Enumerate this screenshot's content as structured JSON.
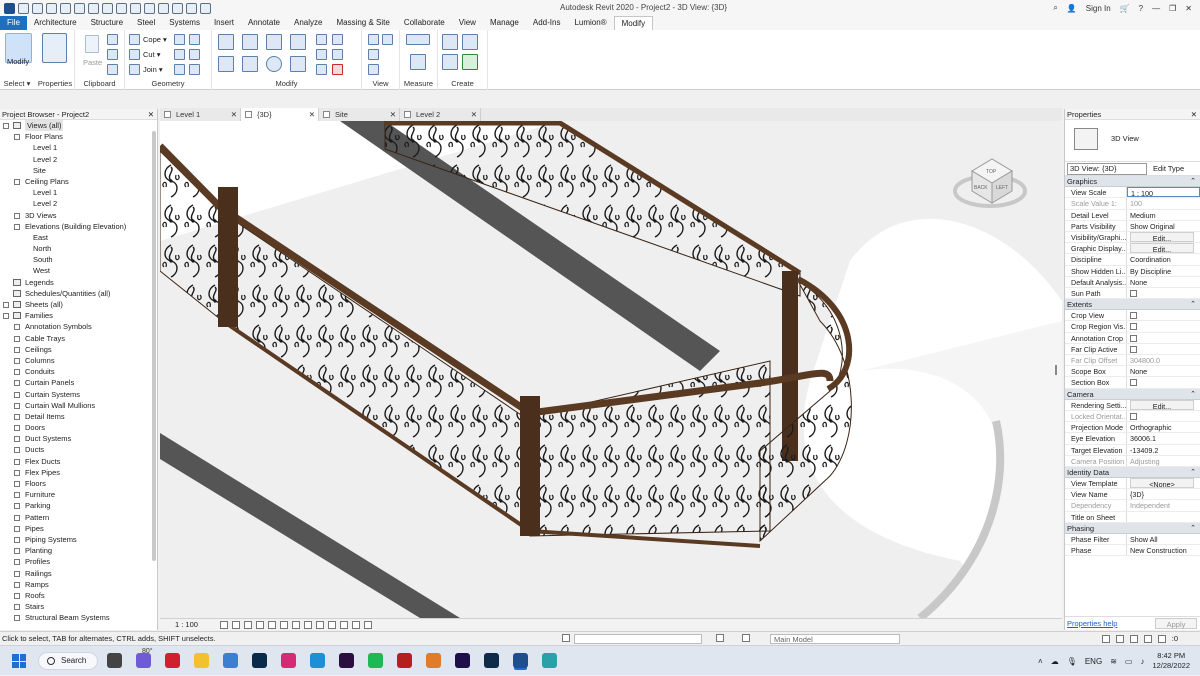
{
  "app": {
    "title": "Autodesk Revit 2020 - Project2 - 3D View: {3D}",
    "sign_in": "Sign In"
  },
  "tabs": [
    "File",
    "Architecture",
    "Structure",
    "Steel",
    "Systems",
    "Insert",
    "Annotate",
    "Analyze",
    "Massing & Site",
    "Collaborate",
    "View",
    "Manage",
    "Add-Ins",
    "Lumion®",
    "Modify"
  ],
  "ribbon": {
    "modify_label": "Modify",
    "panels": {
      "select": "Select ▾",
      "properties": "Properties",
      "clipboard": "Clipboard",
      "geometry": "Geometry",
      "modify": "Modify",
      "view": "View",
      "measure": "Measure",
      "create": "Create"
    },
    "clipboard_paste": "Paste",
    "geometry_items": [
      "Cope ▾",
      "Cut ▾",
      "Join ▾"
    ]
  },
  "project_browser": {
    "title": "Project Browser - Project2",
    "items": [
      {
        "label": "Views (all)",
        "level": 0,
        "tog": "-",
        "icon": true,
        "selected": true
      },
      {
        "label": "Floor Plans",
        "level": 1,
        "tog": "-"
      },
      {
        "label": "Level 1",
        "level": 2
      },
      {
        "label": "Level 2",
        "level": 2
      },
      {
        "label": "Site",
        "level": 2
      },
      {
        "label": "Ceiling Plans",
        "level": 1,
        "tog": "-"
      },
      {
        "label": "Level 1",
        "level": 2
      },
      {
        "label": "Level 2",
        "level": 2
      },
      {
        "label": "3D Views",
        "level": 1,
        "tog": "+"
      },
      {
        "label": "Elevations (Building Elevation)",
        "level": 1,
        "tog": "-"
      },
      {
        "label": "East",
        "level": 2
      },
      {
        "label": "North",
        "level": 2
      },
      {
        "label": "South",
        "level": 2
      },
      {
        "label": "West",
        "level": 2
      },
      {
        "label": "Legends",
        "level": 0,
        "icon": true
      },
      {
        "label": "Schedules/Quantities (all)",
        "level": 0,
        "icon": true
      },
      {
        "label": "Sheets (all)",
        "level": 0,
        "tog": "+",
        "icon": true
      },
      {
        "label": "Families",
        "level": 0,
        "tog": "-",
        "icon": true
      },
      {
        "label": "Annotation Symbols",
        "level": 1,
        "tog": "+"
      },
      {
        "label": "Cable Trays",
        "level": 1,
        "tog": "+"
      },
      {
        "label": "Ceilings",
        "level": 1,
        "tog": "+"
      },
      {
        "label": "Columns",
        "level": 1,
        "tog": "+"
      },
      {
        "label": "Conduits",
        "level": 1,
        "tog": "+"
      },
      {
        "label": "Curtain Panels",
        "level": 1,
        "tog": "+"
      },
      {
        "label": "Curtain Systems",
        "level": 1,
        "tog": "+"
      },
      {
        "label": "Curtain Wall Mullions",
        "level": 1,
        "tog": "+"
      },
      {
        "label": "Detail Items",
        "level": 1,
        "tog": "+"
      },
      {
        "label": "Doors",
        "level": 1,
        "tog": "+"
      },
      {
        "label": "Duct Systems",
        "level": 1,
        "tog": "+"
      },
      {
        "label": "Ducts",
        "level": 1,
        "tog": "+"
      },
      {
        "label": "Flex Ducts",
        "level": 1,
        "tog": "+"
      },
      {
        "label": "Flex Pipes",
        "level": 1,
        "tog": "+"
      },
      {
        "label": "Floors",
        "level": 1,
        "tog": "+"
      },
      {
        "label": "Furniture",
        "level": 1,
        "tog": "+"
      },
      {
        "label": "Parking",
        "level": 1,
        "tog": "+"
      },
      {
        "label": "Pattern",
        "level": 1,
        "tog": "+"
      },
      {
        "label": "Pipes",
        "level": 1,
        "tog": "+"
      },
      {
        "label": "Piping Systems",
        "level": 1,
        "tog": "+"
      },
      {
        "label": "Planting",
        "level": 1,
        "tog": "+"
      },
      {
        "label": "Profiles",
        "level": 1,
        "tog": "+"
      },
      {
        "label": "Railings",
        "level": 1,
        "tog": "+"
      },
      {
        "label": "Ramps",
        "level": 1,
        "tog": "+"
      },
      {
        "label": "Roofs",
        "level": 1,
        "tog": "+"
      },
      {
        "label": "Stairs",
        "level": 1,
        "tog": "+"
      },
      {
        "label": "Structural Beam Systems",
        "level": 1,
        "tog": "+"
      }
    ]
  },
  "view_tabs": [
    {
      "label": "Level 1",
      "active": false
    },
    {
      "label": "{3D}",
      "active": true
    },
    {
      "label": "Site",
      "active": false
    },
    {
      "label": "Level 2",
      "active": false
    }
  ],
  "viewcube": {
    "top": "TOP",
    "front": "BACK",
    "side": "LEFT"
  },
  "view_control_bar": {
    "scale": "1 : 100"
  },
  "properties": {
    "title": "Properties",
    "type_name": "3D View",
    "selector": "3D View: {3D}",
    "edit_type": "Edit Type",
    "groups": [
      {
        "name": "Graphics",
        "rows": [
          {
            "k": "View Scale",
            "v": "1 : 100",
            "edit": true
          },
          {
            "k": "Scale Value    1:",
            "v": "100",
            "dim": true
          },
          {
            "k": "Detail Level",
            "v": "Medium"
          },
          {
            "k": "Parts Visibility",
            "v": "Show Original"
          },
          {
            "k": "Visibility/Graphi...",
            "v": "Edit...",
            "btn": true
          },
          {
            "k": "Graphic Display...",
            "v": "Edit...",
            "btn": true
          },
          {
            "k": "Discipline",
            "v": "Coordination"
          },
          {
            "k": "Show Hidden Li...",
            "v": "By Discipline"
          },
          {
            "k": "Default Analysis...",
            "v": "None"
          },
          {
            "k": "Sun Path",
            "cb": true
          }
        ]
      },
      {
        "name": "Extents",
        "rows": [
          {
            "k": "Crop View",
            "cb": true
          },
          {
            "k": "Crop Region Vis...",
            "cb": true
          },
          {
            "k": "Annotation Crop",
            "cb": true
          },
          {
            "k": "Far Clip Active",
            "cb": true
          },
          {
            "k": "Far Clip Offset",
            "v": "304800.0",
            "dim": true
          },
          {
            "k": "Scope Box",
            "v": "None"
          },
          {
            "k": "Section Box",
            "cb": true
          }
        ]
      },
      {
        "name": "Camera",
        "rows": [
          {
            "k": "Rendering Setti...",
            "v": "Edit...",
            "btn": true
          },
          {
            "k": "Locked Orientat...",
            "cb": true,
            "dim": true
          },
          {
            "k": "Projection Mode",
            "v": "Orthographic"
          },
          {
            "k": "Eye Elevation",
            "v": "36006.1"
          },
          {
            "k": "Target Elevation",
            "v": "-13409.2"
          },
          {
            "k": "Camera Position",
            "v": "Adjusting",
            "dim": true
          }
        ]
      },
      {
        "name": "Identity Data",
        "rows": [
          {
            "k": "View Template",
            "v": "<None>",
            "btn": true
          },
          {
            "k": "View Name",
            "v": "{3D}"
          },
          {
            "k": "Dependency",
            "v": "Independent",
            "dim": true
          },
          {
            "k": "Title on Sheet",
            "v": ""
          }
        ]
      },
      {
        "name": "Phasing",
        "rows": [
          {
            "k": "Phase Filter",
            "v": "Show All"
          },
          {
            "k": "Phase",
            "v": "New Construction"
          }
        ]
      }
    ],
    "help": "Properties help",
    "apply": "Apply"
  },
  "status": {
    "text": "Click to select, TAB for alternates, CTRL adds, SHIFT unselects.",
    "model": "Main Model",
    "filter_count": ":0"
  },
  "taskbar": {
    "search": "Search",
    "temp": "80°",
    "lang": "ENG",
    "time": "8:42 PM",
    "date": "12/28/2022",
    "apps": [
      "task-view",
      "chat",
      "opera",
      "explorer",
      "photos",
      "lightroom",
      "instagram",
      "edge",
      "premiere",
      "spotify",
      "app-red",
      "media",
      "after-effects",
      "photoshop",
      "revit",
      "paint"
    ],
    "colors": {
      "taskview": "#444444",
      "chat": "#6f5bd8",
      "opera": "#d21f2f",
      "explorer": "#f2c12e",
      "photos": "#3c7fd2",
      "lightroom": "#0a2a4a",
      "instagram": "#d62976",
      "edge": "#1d8fd6",
      "premiere": "#2a0f3f",
      "spotify": "#1db954",
      "red": "#b32020",
      "media": "#e07b2a",
      "aftereffects": "#1e0f4a",
      "photoshop": "#0f2b4a",
      "revit": "#1f4e8c",
      "paint": "#2aa0a8"
    }
  }
}
